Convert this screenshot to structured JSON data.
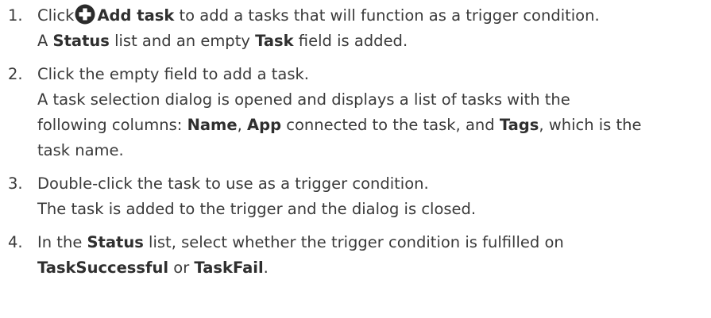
{
  "steps": [
    {
      "number": "1.",
      "action_prefix": "Click",
      "icon": "plus-circle-icon",
      "action_bold": "Add task",
      "action_suffix": " to add a tasks that will function as a trigger condition.",
      "result_a": "A ",
      "result_bold1": "Status",
      "result_b": " list and an empty ",
      "result_bold2": "Task",
      "result_c": " field is added."
    },
    {
      "number": "2.",
      "action": "Click the empty field to add a task.",
      "result_line1": "A task selection dialog is opened and displays a list of tasks with the",
      "result_l2_a": "following columns: ",
      "result_l2_bold1": "Name",
      "result_l2_b": ", ",
      "result_l2_bold2": "App",
      "result_l2_c": " connected to the task, and ",
      "result_l2_bold3": "Tags",
      "result_l2_d": ", which is the",
      "result_line3": "task name."
    },
    {
      "number": "3.",
      "action": "Double-click the task to use as a trigger condition.",
      "result": "The task is added to the trigger and the dialog is closed."
    },
    {
      "number": "4.",
      "action_a": "In the ",
      "action_bold": "Status",
      "action_b": " list, select whether the trigger condition is fulfilled on",
      "line2_bold1": "TaskSuccessful",
      "line2_a": " or ",
      "line2_bold2": "TaskFail",
      "line2_b": "."
    }
  ]
}
